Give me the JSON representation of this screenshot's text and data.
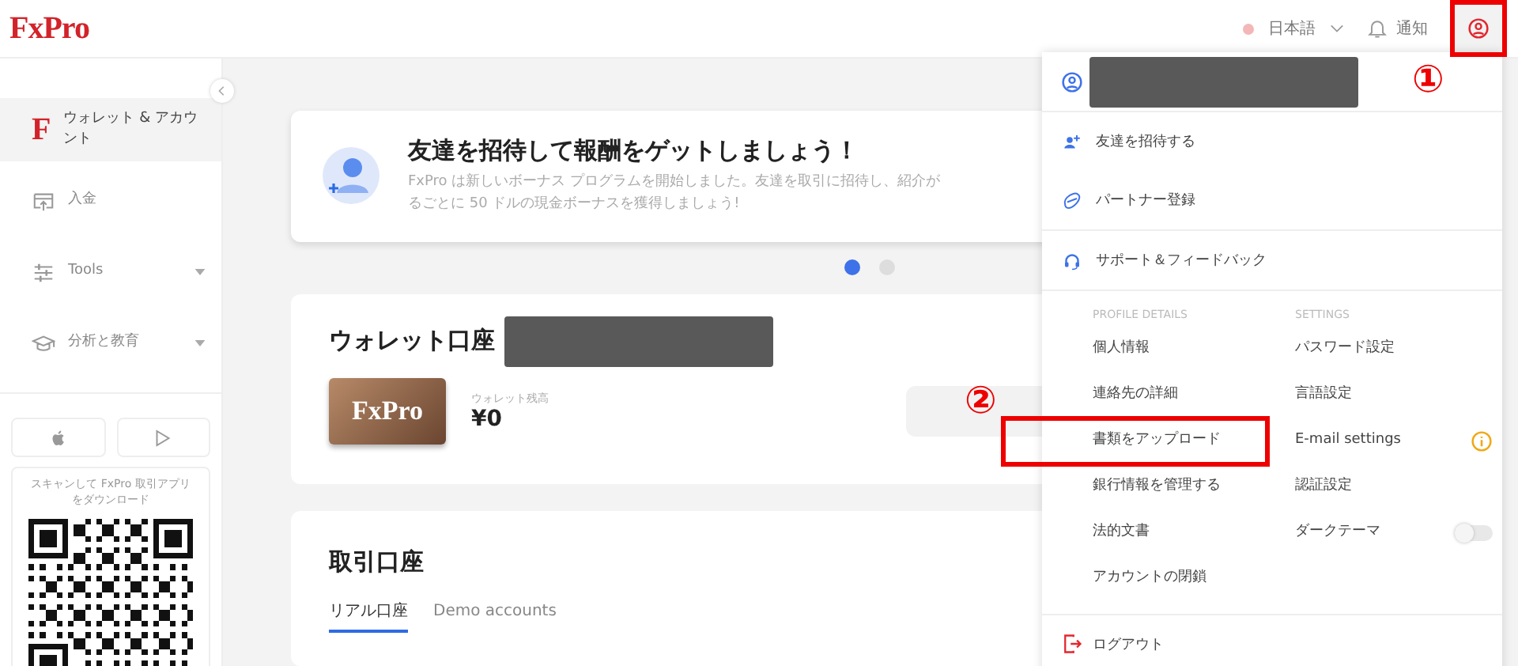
{
  "header": {
    "logo": "FxPro",
    "language": "日本語",
    "notifications": "通知"
  },
  "sidebar": {
    "items": [
      {
        "label": "ウォレット & アカウント",
        "kind": "brand",
        "brand_mark": "F",
        "selected": true
      },
      {
        "label": "入金",
        "kind": "deposit",
        "selected": false
      },
      {
        "label": "Tools",
        "kind": "tools",
        "selected": false,
        "expandable": true
      },
      {
        "label": "分析と教育",
        "kind": "education",
        "selected": false,
        "expandable": true
      }
    ],
    "app_caption": "スキャンして FxPro 取引アプリをダウンロード"
  },
  "banner": {
    "title": "友達を招待して報酬をゲットしましょう！",
    "lines": [
      "FxPro は新しいボーナス プログラムを開始しました。友達を取引に招待し、紹介が",
      "るごとに 50 ドルの現金ボーナスを獲得しましょう!"
    ]
  },
  "carousel_dots": [
    {
      "selected": true
    },
    {
      "selected": false
    }
  ],
  "wallet": {
    "title": "ウォレット口座",
    "logo": "FxPro",
    "balance_label": "ウォレット残高",
    "balance": "¥0"
  },
  "trading": {
    "title": "取引口座",
    "tabs": [
      {
        "label": "リアル口座",
        "selected": true
      },
      {
        "label": "Demo accounts",
        "selected": false
      }
    ]
  },
  "menu": {
    "links": [
      {
        "label": "友達を招待する",
        "kind": "invite"
      },
      {
        "label": "パートナー登録",
        "kind": "partner"
      },
      {
        "label": "サポート＆フィードバック",
        "kind": "support"
      }
    ],
    "profile_heading": "PROFILE DETAILS",
    "settings_heading": "SETTINGS",
    "profile_items": [
      "個人情報",
      "連絡先の詳細",
      "書類をアップロード",
      "銀行情報を管理する",
      "法的文書",
      "アカウントの閉鎖"
    ],
    "settings_items": [
      {
        "label": "パスワード設定",
        "kind": "plain"
      },
      {
        "label": "言語設定",
        "kind": "plain"
      },
      {
        "label": "E-mail settings",
        "kind": "warning"
      },
      {
        "label": "認証設定",
        "kind": "plain"
      },
      {
        "label": "ダークテーマ",
        "kind": "toggle",
        "on": false
      }
    ],
    "logout": "ログアウト"
  },
  "annotations": [
    "①",
    "②"
  ]
}
